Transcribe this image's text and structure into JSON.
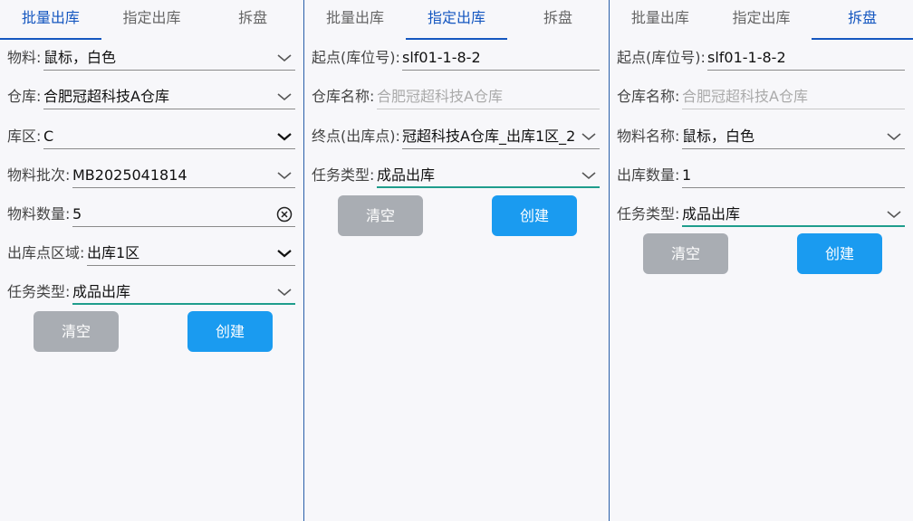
{
  "tabs": [
    "批量出库",
    "指定出库",
    "拆盘"
  ],
  "buttons": {
    "clear": "清空",
    "create": "创建"
  },
  "panel1": {
    "material_label": "物料:",
    "material_value": "鼠标，白色",
    "warehouse_label": "仓库:",
    "warehouse_value": "合肥冠超科技A仓库",
    "zone_label": "库区:",
    "zone_value": "C",
    "batch_label": "物料批次:",
    "batch_value": "MB2025041814",
    "qty_label": "物料数量:",
    "qty_value": "5",
    "outzone_label": "出库点区域:",
    "outzone_value": "出库1区",
    "task_label": "任务类型:",
    "task_value": "成品出库"
  },
  "panel2": {
    "start_label": "起点(库位号):",
    "start_value": "slf01-1-8-2",
    "wh_name_label": "仓库名称:",
    "wh_name_placeholder": "合肥冠超科技A仓库",
    "end_label": "终点(出库点):",
    "end_value": "冠超科技A仓库_出库1区_2",
    "task_label": "任务类型:",
    "task_value": "成品出库"
  },
  "panel3": {
    "start_label": "起点(库位号):",
    "start_value": "slf01-1-8-2",
    "wh_name_label": "仓库名称:",
    "wh_name_placeholder": "合肥冠超科技A仓库",
    "mat_name_label": "物料名称:",
    "mat_name_value": "鼠标，白色",
    "qty_label": "出库数量:",
    "qty_value": "1",
    "task_label": "任务类型:",
    "task_value": "成品出库"
  }
}
